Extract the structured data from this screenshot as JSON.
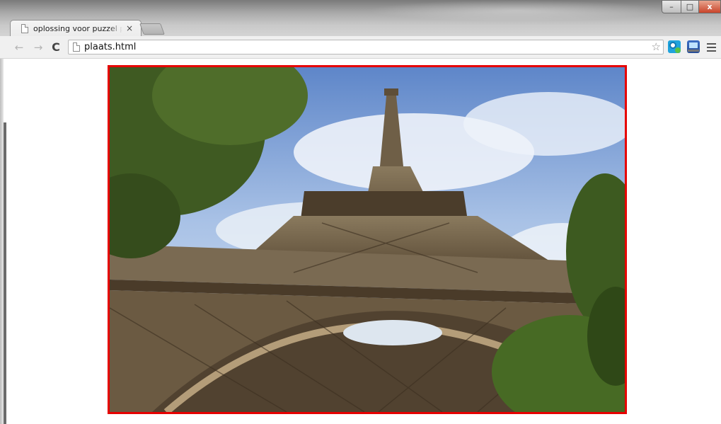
{
  "browser": {
    "tabs": [
      {
        "title": "oplossing voor puzzel plaats",
        "active": true
      }
    ],
    "new_tab": {
      "label": ""
    },
    "window_controls": {
      "minimize": "–",
      "maximize": "□",
      "close": "x"
    },
    "nav": {
      "back": "←",
      "forward": "→",
      "reload": "C"
    },
    "address_bar": {
      "url": "plaats.html",
      "bookmark_icon": "star-icon"
    },
    "extensions": [
      "skype-icon",
      "screen-capture-icon"
    ],
    "menu_icon": "hamburger-menu-icon"
  },
  "page": {
    "image": {
      "subject": "Eiffel Tower",
      "border_color": "#e60000"
    }
  }
}
